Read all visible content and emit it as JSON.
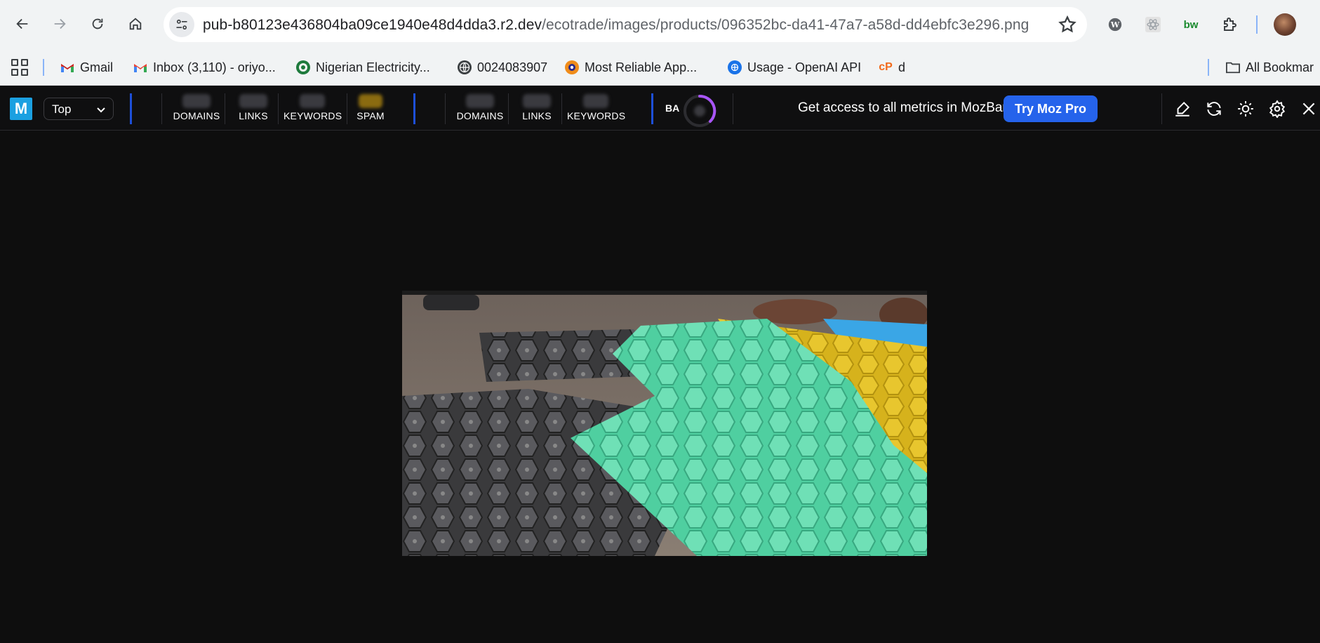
{
  "browser": {
    "url_host": "pub-b80123e436804ba09ce1940e48d4dda3.r2.dev",
    "url_path": "/ecotrade/images/products/096352bc-da41-47a7-a58d-dd4ebfc3e296.png",
    "nav_icons": [
      "back-icon",
      "forward-icon",
      "reload-icon",
      "home-icon"
    ],
    "extension_icons": [
      "wordpress-icon",
      "react-devtools-icon",
      "bw-extension-icon",
      "puzzle-extensions-icon"
    ]
  },
  "bookmarks": {
    "items": [
      {
        "label": "Gmail",
        "icon": "gmail-icon"
      },
      {
        "label": "Inbox (3,110) - oriyo...",
        "icon": "gmail-icon"
      },
      {
        "label": "Nigerian Electricity...",
        "icon": "nerc-logo-icon"
      },
      {
        "label": "0024083907",
        "icon": "globe-icon"
      },
      {
        "label": "Most Reliable App...",
        "icon": "app-logo-icon"
      },
      {
        "label": "Usage - OpenAI API",
        "icon": "openai-icon"
      },
      {
        "label": "d",
        "icon": "cpanel-icon"
      }
    ],
    "all_bookmarks": "All Bookmar"
  },
  "mozbar": {
    "scope": "Top",
    "page_metrics": [
      "DOMAINS",
      "LINKS",
      "KEYWORDS",
      "SPAM"
    ],
    "domain_metrics": [
      "DOMAINS",
      "LINKS",
      "KEYWORDS"
    ],
    "ba_label": "BA",
    "promo_text": "Get access to all metrics in MozBar",
    "cta_label": "Try Moz Pro",
    "colors": {
      "accent": "#2563eb",
      "divider": "#1d4fd8",
      "ring": "#a855f7"
    }
  },
  "image": {
    "description_alt": "photo"
  }
}
